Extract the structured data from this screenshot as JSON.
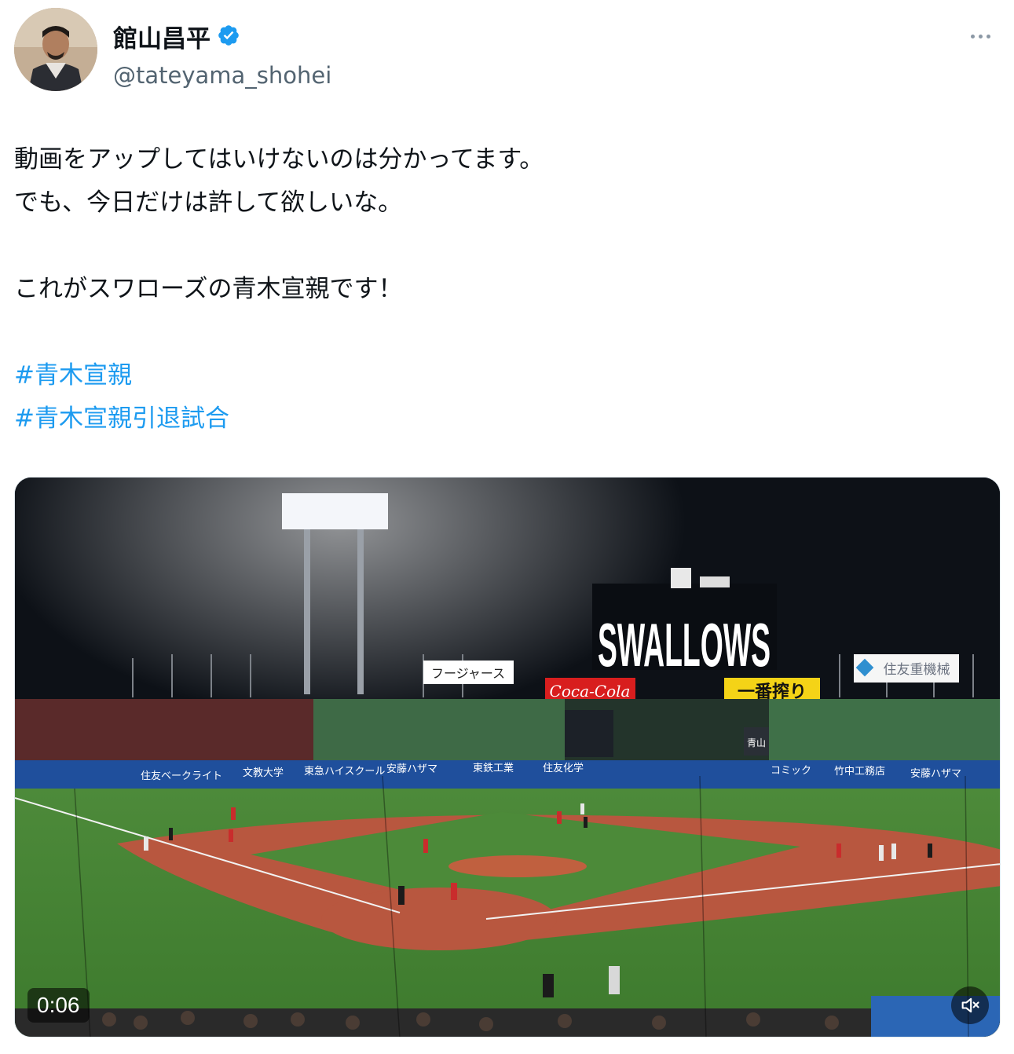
{
  "author": {
    "display_name": "館山昌平",
    "handle": "@tateyama_shohei",
    "verified_icon": "verified-badge-icon",
    "avatar_icon": "avatar"
  },
  "more_icon": "more-horizontal-icon",
  "tweet": {
    "line1": "動画をアップしてはいけないのは分かってます。",
    "line2": "でも、今日だけは許して欲しいな。",
    "line3": "これがスワローズの青木宣親です！",
    "hashtag1": "#青木宣親",
    "hashtag2": "#青木宣親引退試合"
  },
  "video": {
    "timestamp": "0:06",
    "mute_icon": "volume-muted-icon",
    "signs": {
      "scoreboard": "SWALLOWS",
      "left_board": "フージャース",
      "coca_cola": "Coca-Cola",
      "ichiban": "一番搾り",
      "sumitomo": "住友重機械",
      "fence_1": "住友ベークライト",
      "fence_2": "文教大学",
      "fence_3": "東急ハイスクール",
      "fence_4": "安藤ハザマ",
      "fence_5": "東鉄工業",
      "fence_6": "住友化学",
      "fence_7": "コミック",
      "fence_8": "竹中工務店",
      "fence_9": "安藤ハザマ",
      "aoyama": "青山"
    }
  },
  "colors": {
    "hashtag": "#1d9bf0",
    "verified": "#1d9bf0",
    "handle": "#536471"
  }
}
